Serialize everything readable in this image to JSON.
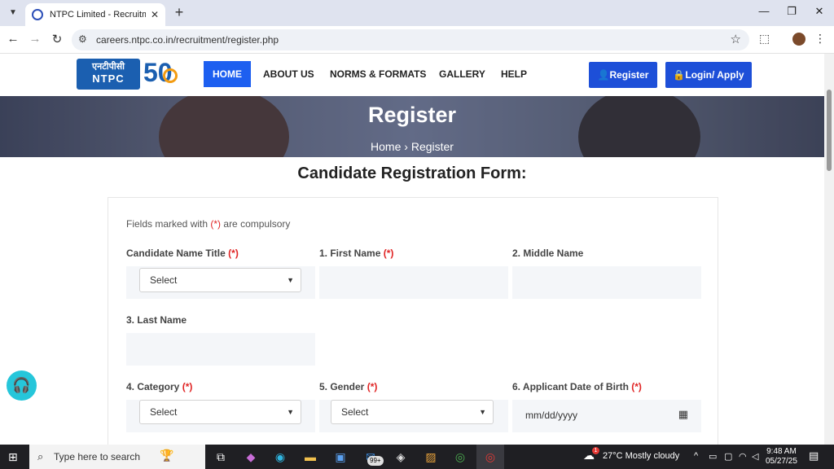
{
  "browser": {
    "tab_title": "NTPC Limited - Recruitment Po",
    "url": "careers.ntpc.co.in/recruitment/register.php"
  },
  "header": {
    "logo_hindi": "एनटीपीसी",
    "logo_text": "NTPC",
    "anniversary_number": "50",
    "nav": [
      "HOME",
      "ABOUT US",
      "NORMS & FORMATS",
      "GALLERY",
      "HELP"
    ],
    "register_label": "Register",
    "login_label": "Login/ Apply"
  },
  "hero": {
    "title": "Register",
    "breadcrumb_home": "Home",
    "breadcrumb_sep": "›",
    "breadcrumb_current": "Register"
  },
  "form": {
    "heading": "Candidate Registration Form:",
    "note_prefix": "Fields marked with",
    "note_marker": "(*)",
    "note_suffix": "are compulsory",
    "required_marker": "(*)",
    "labels": {
      "name_title": "Candidate Name Title",
      "first_name": "1. First Name",
      "middle_name": "2. Middle Name",
      "last_name": "3. Last Name",
      "category": "4. Category",
      "gender": "5. Gender",
      "dob": "6. Applicant Date of Birth"
    },
    "select_placeholder": "Select",
    "date_placeholder": "mm/dd/yyyy"
  },
  "taskbar": {
    "search_placeholder": "Type here to search",
    "mail_badge": "99+",
    "weather": "27°C  Mostly cloudy",
    "weather_alert": "1",
    "time": "9:48 AM",
    "date": "05/27/25"
  }
}
